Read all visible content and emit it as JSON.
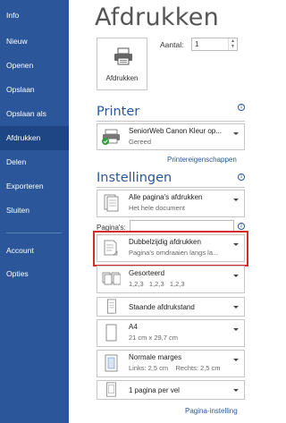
{
  "sidebar": {
    "items": [
      {
        "label": "Info"
      },
      {
        "label": "Nieuw"
      },
      {
        "label": "Openen"
      },
      {
        "label": "Opslaan"
      },
      {
        "label": "Opslaan als"
      },
      {
        "label": "Afdrukken"
      },
      {
        "label": "Delen"
      },
      {
        "label": "Exporteren"
      },
      {
        "label": "Sluiten"
      },
      {
        "label": "Account"
      },
      {
        "label": "Opties"
      }
    ],
    "active": "Afdrukken"
  },
  "main": {
    "title": "Afdrukken",
    "print_button_label": "Afdrukken",
    "copies_label": "Aantal:",
    "copies_value": "1",
    "printer": {
      "heading": "Printer",
      "name": "SeniorWeb Canon Kleur op...",
      "status": "Gereed",
      "properties_link": "Printereigenschappen"
    },
    "settings": {
      "heading": "Instellingen",
      "pages_label": "Pagina's:",
      "options": [
        {
          "main": "Alle pagina's afdrukken",
          "sub": "Het hele document"
        },
        {
          "main": "Dubbelzijdig afdrukken",
          "sub": "Pagina's omdraaien langs la..."
        },
        {
          "main": "Gesorteerd",
          "sub": "1,2,3   1,2,3   1,2,3"
        },
        {
          "main": "Staande afdrukstand",
          "sub": ""
        },
        {
          "main": "A4",
          "sub": "21 cm x 29,7 cm"
        },
        {
          "main": "Normale marges",
          "sub": "Links: 2,5 cm    Rechts: 2,5 cm"
        },
        {
          "main": "1 pagina per vel",
          "sub": ""
        }
      ],
      "page_setup_link": "Pagina-instelling"
    }
  },
  "colors": {
    "sidebar": "#2b579a",
    "active": "#1e4684",
    "highlight": "#d42b2b"
  }
}
